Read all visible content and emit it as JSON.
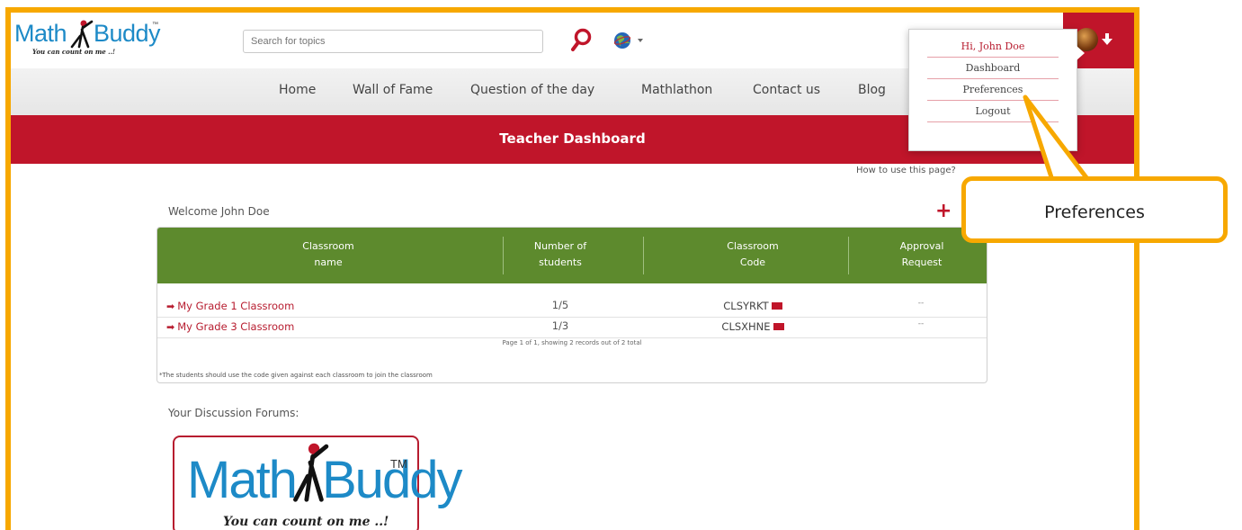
{
  "header": {
    "logo_text_1": "Math",
    "logo_text_2": "Buddy",
    "logo_tm": "™",
    "logo_tagline": "You can count on me ..!",
    "search_placeholder": "Search for topics"
  },
  "nav": {
    "items": [
      "Home",
      "Wall of Fame",
      "Question of the day",
      "Mathlathon",
      "Contact us",
      "Blog"
    ]
  },
  "page_title": "Teacher Dashboard",
  "help_link": "How to use this page?",
  "welcome": "Welcome John Doe",
  "add_icon": "plus-icon",
  "user_menu": {
    "greeting": "Hi, John Doe",
    "items": [
      "Dashboard",
      "Preferences",
      "Logout"
    ]
  },
  "table": {
    "headers": [
      [
        "Classroom",
        "name"
      ],
      [
        "Number of",
        "students"
      ],
      [
        "Classroom",
        "Code"
      ],
      [
        "Approval",
        "Request"
      ]
    ],
    "rows": [
      {
        "name": "My Grade 1 Classroom",
        "students": "1/5",
        "code": "CLSYRKT",
        "approval": "--"
      },
      {
        "name": "My Grade 3 Classroom",
        "students": "1/3",
        "code": "CLSXHNE",
        "approval": "--"
      }
    ],
    "pager": "Page 1 of 1, showing 2 records out of 2 total",
    "footnote": "*The students should use the code given against each classroom to join the classroom"
  },
  "forums_label": "Your Discussion Forums:",
  "forum_card": {
    "logo_text_1": "Math",
    "logo_text_2": "Buddy",
    "logo_tm": "TM",
    "tagline": "You can count on me ..!"
  },
  "callout": "Preferences",
  "colors": {
    "brand_red": "#c0152a",
    "table_green": "#5d8a2d",
    "frame_orange": "#f7a800",
    "logo_blue": "#1d8ac7"
  }
}
